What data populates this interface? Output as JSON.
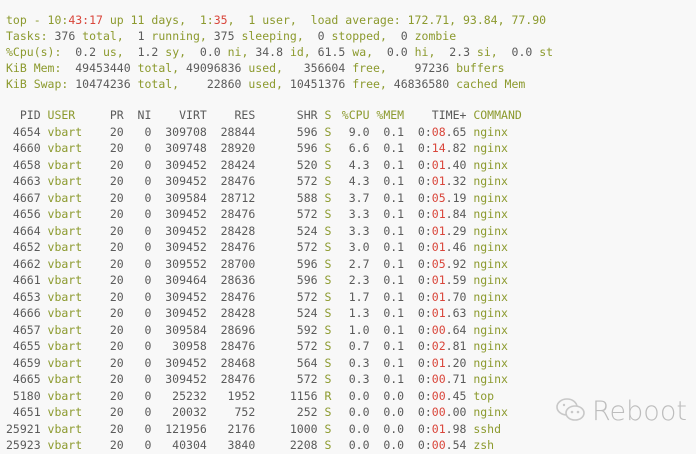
{
  "summary": [
    [
      {
        "t": "top - 10:",
        "c": "w"
      },
      {
        "t": "43:17",
        "c": "r"
      },
      {
        "t": " up 11 days,  1:",
        "c": "w"
      },
      {
        "t": "35",
        "c": "r"
      },
      {
        "t": ",  1 user,  load average: 172.71, 93.84, 77.90",
        "c": "w"
      }
    ],
    [
      {
        "t": "Tasks: ",
        "c": "w"
      },
      {
        "t": "376",
        "c": "n"
      },
      {
        "t": " total,  ",
        "c": "w"
      },
      {
        "t": "1",
        "c": "n"
      },
      {
        "t": " running, ",
        "c": "w"
      },
      {
        "t": "375",
        "c": "n"
      },
      {
        "t": " sleeping,  ",
        "c": "w"
      },
      {
        "t": "0",
        "c": "n"
      },
      {
        "t": " stopped,  ",
        "c": "w"
      },
      {
        "t": "0",
        "c": "n"
      },
      {
        "t": " zombie",
        "c": "w"
      }
    ],
    [
      {
        "t": "%Cpu(s):  ",
        "c": "w"
      },
      {
        "t": "0.2",
        "c": "n"
      },
      {
        "t": " us,  ",
        "c": "w"
      },
      {
        "t": "1.2",
        "c": "n"
      },
      {
        "t": " sy,  ",
        "c": "w"
      },
      {
        "t": "0.0",
        "c": "n"
      },
      {
        "t": " ni, ",
        "c": "w"
      },
      {
        "t": "34.8",
        "c": "n"
      },
      {
        "t": " id, ",
        "c": "w"
      },
      {
        "t": "61.5",
        "c": "n"
      },
      {
        "t": " wa,  ",
        "c": "w"
      },
      {
        "t": "0.0",
        "c": "n"
      },
      {
        "t": " hi,  ",
        "c": "w"
      },
      {
        "t": "2.3",
        "c": "n"
      },
      {
        "t": " si,  ",
        "c": "w"
      },
      {
        "t": "0.0",
        "c": "n"
      },
      {
        "t": " st",
        "c": "w"
      }
    ],
    [
      {
        "t": "KiB Mem:  ",
        "c": "w"
      },
      {
        "t": "49453440",
        "c": "n"
      },
      {
        "t": " total, ",
        "c": "w"
      },
      {
        "t": "49096836",
        "c": "n"
      },
      {
        "t": " used,   ",
        "c": "w"
      },
      {
        "t": "356604",
        "c": "n"
      },
      {
        "t": " free,    ",
        "c": "w"
      },
      {
        "t": "97236",
        "c": "n"
      },
      {
        "t": " buffers",
        "c": "w"
      }
    ],
    [
      {
        "t": "KiB Swap: ",
        "c": "w"
      },
      {
        "t": "10474236",
        "c": "n"
      },
      {
        "t": " total,    ",
        "c": "w"
      },
      {
        "t": "22860",
        "c": "n"
      },
      {
        "t": " used, ",
        "c": "w"
      },
      {
        "t": "10451376",
        "c": "n"
      },
      {
        "t": " free, ",
        "c": "w"
      },
      {
        "t": "46836580",
        "c": "n"
      },
      {
        "t": " cached Mem",
        "c": "w"
      }
    ]
  ],
  "columns": {
    "pid": "PID",
    "user": "USER",
    "pr": "PR",
    "ni": "NI",
    "virt": "VIRT",
    "res": "RES",
    "shr": "SHR",
    "s": "S",
    "cpu": "%CPU",
    "mem": "%MEM",
    "time": "TIME+",
    "cmd": "COMMAND"
  },
  "processes": [
    {
      "pid": "4654",
      "user": "vbart",
      "pr": "20",
      "ni": "0",
      "virt": "309708",
      "res": "28844",
      "shr": "596",
      "s": "S",
      "cpu": "9.0",
      "mem": "0.1",
      "t1": "0:",
      "t2": "08",
      "t3": ".65",
      "cmd": "nginx"
    },
    {
      "pid": "4660",
      "user": "vbart",
      "pr": "20",
      "ni": "0",
      "virt": "309748",
      "res": "28920",
      "shr": "596",
      "s": "S",
      "cpu": "6.6",
      "mem": "0.1",
      "t1": "0:",
      "t2": "14",
      "t3": ".82",
      "cmd": "nginx"
    },
    {
      "pid": "4658",
      "user": "vbart",
      "pr": "20",
      "ni": "0",
      "virt": "309452",
      "res": "28424",
      "shr": "520",
      "s": "S",
      "cpu": "4.3",
      "mem": "0.1",
      "t1": "0:",
      "t2": "01",
      "t3": ".40",
      "cmd": "nginx"
    },
    {
      "pid": "4663",
      "user": "vbart",
      "pr": "20",
      "ni": "0",
      "virt": "309452",
      "res": "28476",
      "shr": "572",
      "s": "S",
      "cpu": "4.3",
      "mem": "0.1",
      "t1": "0:",
      "t2": "01",
      "t3": ".32",
      "cmd": "nginx"
    },
    {
      "pid": "4667",
      "user": "vbart",
      "pr": "20",
      "ni": "0",
      "virt": "309584",
      "res": "28712",
      "shr": "588",
      "s": "S",
      "cpu": "3.7",
      "mem": "0.1",
      "t1": "0:",
      "t2": "05",
      "t3": ".19",
      "cmd": "nginx"
    },
    {
      "pid": "4656",
      "user": "vbart",
      "pr": "20",
      "ni": "0",
      "virt": "309452",
      "res": "28476",
      "shr": "572",
      "s": "S",
      "cpu": "3.3",
      "mem": "0.1",
      "t1": "0:",
      "t2": "01",
      "t3": ".84",
      "cmd": "nginx"
    },
    {
      "pid": "4664",
      "user": "vbart",
      "pr": "20",
      "ni": "0",
      "virt": "309452",
      "res": "28428",
      "shr": "524",
      "s": "S",
      "cpu": "3.3",
      "mem": "0.1",
      "t1": "0:",
      "t2": "01",
      "t3": ".29",
      "cmd": "nginx"
    },
    {
      "pid": "4652",
      "user": "vbart",
      "pr": "20",
      "ni": "0",
      "virt": "309452",
      "res": "28476",
      "shr": "572",
      "s": "S",
      "cpu": "3.0",
      "mem": "0.1",
      "t1": "0:",
      "t2": "01",
      "t3": ".46",
      "cmd": "nginx"
    },
    {
      "pid": "4662",
      "user": "vbart",
      "pr": "20",
      "ni": "0",
      "virt": "309552",
      "res": "28700",
      "shr": "596",
      "s": "S",
      "cpu": "2.7",
      "mem": "0.1",
      "t1": "0:",
      "t2": "05",
      "t3": ".92",
      "cmd": "nginx"
    },
    {
      "pid": "4661",
      "user": "vbart",
      "pr": "20",
      "ni": "0",
      "virt": "309464",
      "res": "28636",
      "shr": "596",
      "s": "S",
      "cpu": "2.3",
      "mem": "0.1",
      "t1": "0:",
      "t2": "01",
      "t3": ".59",
      "cmd": "nginx"
    },
    {
      "pid": "4653",
      "user": "vbart",
      "pr": "20",
      "ni": "0",
      "virt": "309452",
      "res": "28476",
      "shr": "572",
      "s": "S",
      "cpu": "1.7",
      "mem": "0.1",
      "t1": "0:",
      "t2": "01",
      "t3": ".70",
      "cmd": "nginx"
    },
    {
      "pid": "4666",
      "user": "vbart",
      "pr": "20",
      "ni": "0",
      "virt": "309452",
      "res": "28428",
      "shr": "524",
      "s": "S",
      "cpu": "1.3",
      "mem": "0.1",
      "t1": "0:",
      "t2": "01",
      "t3": ".63",
      "cmd": "nginx"
    },
    {
      "pid": "4657",
      "user": "vbart",
      "pr": "20",
      "ni": "0",
      "virt": "309584",
      "res": "28696",
      "shr": "592",
      "s": "S",
      "cpu": "1.0",
      "mem": "0.1",
      "t1": "0:",
      "t2": "00",
      "t3": ".64",
      "cmd": "nginx"
    },
    {
      "pid": "4655",
      "user": "vbart",
      "pr": "20",
      "ni": "0",
      "virt": "30958",
      "res": "28476",
      "shr": "572",
      "s": "S",
      "cpu": "0.7",
      "mem": "0.1",
      "t1": "0:",
      "t2": "02",
      "t3": ".81",
      "cmd": "nginx"
    },
    {
      "pid": "4659",
      "user": "vbart",
      "pr": "20",
      "ni": "0",
      "virt": "309452",
      "res": "28468",
      "shr": "564",
      "s": "S",
      "cpu": "0.3",
      "mem": "0.1",
      "t1": "0:",
      "t2": "01",
      "t3": ".20",
      "cmd": "nginx"
    },
    {
      "pid": "4665",
      "user": "vbart",
      "pr": "20",
      "ni": "0",
      "virt": "309452",
      "res": "28476",
      "shr": "572",
      "s": "S",
      "cpu": "0.3",
      "mem": "0.1",
      "t1": "0:",
      "t2": "00",
      "t3": ".71",
      "cmd": "nginx"
    },
    {
      "pid": "5180",
      "user": "vbart",
      "pr": "20",
      "ni": "0",
      "virt": "25232",
      "res": "1952",
      "shr": "1156",
      "s": "R",
      "cpu": "0.0",
      "mem": "0.0",
      "t1": "0:",
      "t2": "00",
      "t3": ".45",
      "cmd": "top"
    },
    {
      "pid": "4651",
      "user": "vbart",
      "pr": "20",
      "ni": "0",
      "virt": "20032",
      "res": "752",
      "shr": "252",
      "s": "S",
      "cpu": "0.0",
      "mem": "0.0",
      "t1": "0:",
      "t2": "00",
      "t3": ".00",
      "cmd": "nginx"
    },
    {
      "pid": "25921",
      "user": "vbart",
      "pr": "20",
      "ni": "0",
      "virt": "121956",
      "res": "2176",
      "shr": "1000",
      "s": "S",
      "cpu": "0.0",
      "mem": "0.0",
      "t1": "0:",
      "t2": "01",
      "t3": ".98",
      "cmd": "sshd"
    },
    {
      "pid": "25923",
      "user": "vbart",
      "pr": "20",
      "ni": "0",
      "virt": "40304",
      "res": "3840",
      "shr": "2208",
      "s": "S",
      "cpu": "0.0",
      "mem": "0.0",
      "t1": "0:",
      "t2": "00",
      "t3": ".54",
      "cmd": "zsh"
    }
  ],
  "watermark": {
    "text": "Reboot",
    "icon": "wechat-icon"
  }
}
